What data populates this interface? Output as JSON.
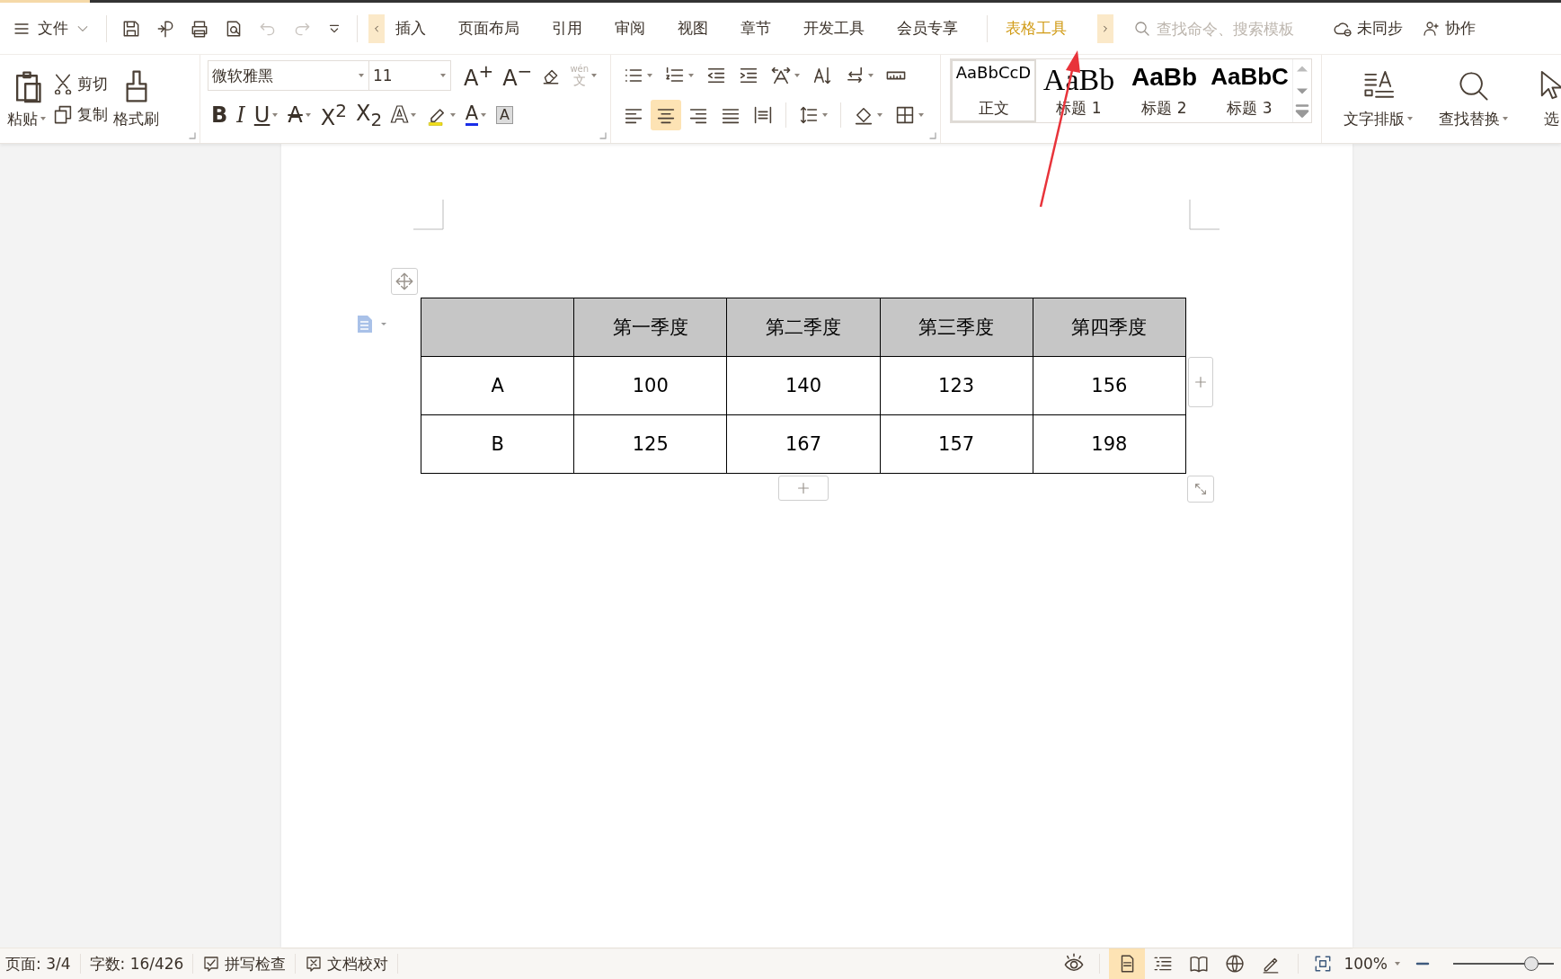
{
  "menu": {
    "file": "文件",
    "tabs": [
      {
        "label": "插入",
        "kind": "normal",
        "selected": false
      },
      {
        "label": "页面布局",
        "kind": "normal",
        "selected": false
      },
      {
        "label": "引用",
        "kind": "normal",
        "selected": false
      },
      {
        "label": "审阅",
        "kind": "normal",
        "selected": false
      },
      {
        "label": "视图",
        "kind": "normal",
        "selected": false
      },
      {
        "label": "章节",
        "kind": "normal",
        "selected": false
      },
      {
        "label": "开发工具",
        "kind": "normal",
        "selected": false
      },
      {
        "label": "会员专享",
        "kind": "normal",
        "selected": false
      },
      {
        "label": "表格工具",
        "kind": "context",
        "selected": false
      }
    ],
    "search": {
      "placeholder": "查找命令、搜索模板"
    },
    "sync": "未同步",
    "collab": "协作"
  },
  "clipboard": {
    "paste": "粘贴",
    "cut": "剪切",
    "copy": "复制",
    "painter": "格式刷"
  },
  "font": {
    "name": "微软雅黑",
    "size": "11"
  },
  "font_tools_top": [
    {
      "kind": "grow",
      "glyph": "A$^{+}$"
    },
    {
      "kind": "shrink",
      "glyph": "A$^{−}$"
    },
    {
      "kind": "clear"
    },
    {
      "kind": "phonetic",
      "top": "wén",
      "glyph": "文",
      "disabled": true
    }
  ],
  "font_tools_bottom": [
    {
      "kind": "bold",
      "glyph": "B"
    },
    {
      "kind": "italic",
      "glyph": "I"
    },
    {
      "kind": "underline",
      "glyph": "U"
    },
    {
      "kind": "strike",
      "glyph": "A"
    },
    {
      "kind": "superscript",
      "glyph": "X$^{2}$"
    },
    {
      "kind": "subscript",
      "glyph": "X$_{2}$"
    },
    {
      "kind": "effects",
      "glyph": "A"
    },
    {
      "kind": "highlight"
    },
    {
      "kind": "color",
      "glyph": "A"
    },
    {
      "kind": "shade",
      "glyph": "A"
    }
  ],
  "alignment": [
    {
      "kind": "left",
      "selected": false
    },
    {
      "kind": "center",
      "selected": true
    },
    {
      "kind": "right",
      "selected": false
    },
    {
      "kind": "justify",
      "selected": false
    },
    {
      "kind": "distributed",
      "selected": false
    }
  ],
  "styles": [
    {
      "preview": "AaBbCcD",
      "label": "正文",
      "kind": "normal",
      "selected": true
    },
    {
      "preview": "AaBb",
      "label": "标题 1",
      "kind": "h1",
      "selected": false
    },
    {
      "preview": "AaBb",
      "label": "标题 2",
      "kind": "h2",
      "selected": false
    },
    {
      "preview": "AaBbC",
      "label": "标题 3",
      "kind": "h3",
      "selected": false
    }
  ],
  "big_buttons": [
    {
      "label": "文字排版",
      "kind": "layout",
      "dropdown": true
    },
    {
      "label": "查找替换",
      "kind": "find",
      "dropdown": true
    },
    {
      "label": "选",
      "kind": "select",
      "dropdown": false
    }
  ],
  "table": {
    "columns": [
      "第一季度",
      "第二季度",
      "第三季度",
      "第四季度"
    ],
    "rows": [
      {
        "label": "A",
        "cells": [
          "100",
          "140",
          "123",
          "156"
        ]
      },
      {
        "label": "B",
        "cells": [
          "125",
          "167",
          "157",
          "198"
        ]
      }
    ]
  },
  "status": {
    "page": "页面: 3/4",
    "words": "字数: 16/426",
    "spell": "拼写检查",
    "proof": "文档校对",
    "views": [
      {
        "kind": "page",
        "selected": true
      },
      {
        "kind": "outline",
        "selected": false
      },
      {
        "kind": "reading",
        "selected": false
      },
      {
        "kind": "web",
        "selected": false
      },
      {
        "kind": "writing",
        "selected": false
      }
    ],
    "zoom": "100%",
    "zoom_slider": {
      "level": 0.78
    }
  }
}
